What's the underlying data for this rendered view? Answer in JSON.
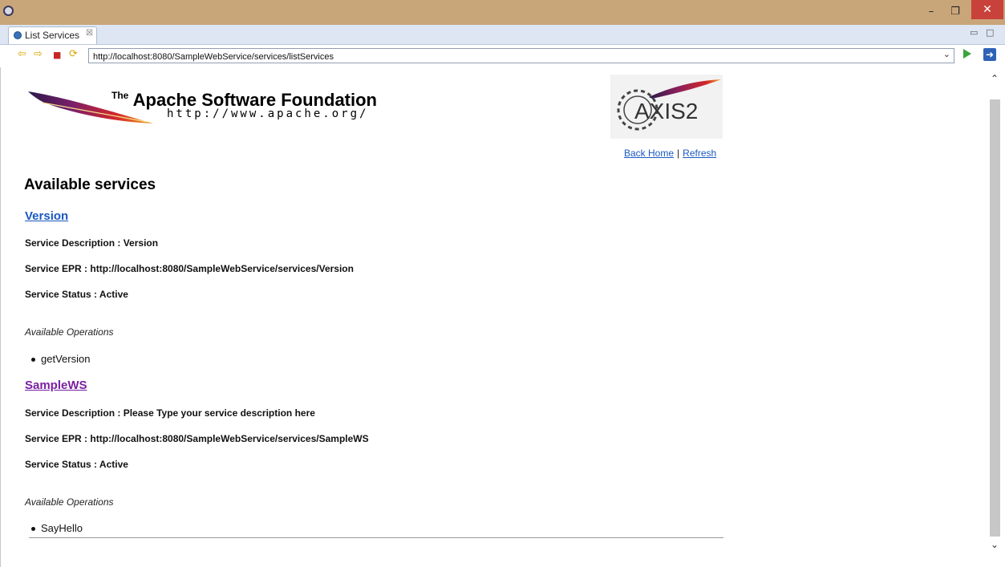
{
  "window": {
    "minimize": "–",
    "restore": "❐",
    "close": "✕"
  },
  "tab": {
    "label": "List Services",
    "close": "☒"
  },
  "tabbar": {
    "minimize": "▭",
    "maximize": "□"
  },
  "nav": {
    "url": "http://localhost:8080/SampleWebService/services/listServices",
    "dropdown": "⌄"
  },
  "header": {
    "asf_the": "The",
    "asf_title": "Apache Software Foundation",
    "asf_url": "http://www.apache.org/",
    "axis_logo_text": "AXIS2",
    "back_home": "Back Home",
    "separator": "|",
    "refresh": "Refresh"
  },
  "page": {
    "heading": "Available services",
    "services": [
      {
        "name": "Version",
        "description": "Service Description : Version",
        "epr": "Service EPR : http://localhost:8080/SampleWebService/services/Version",
        "status": "Service Status : Active",
        "operations_heading": "Available Operations",
        "operations": [
          "getVersion"
        ]
      },
      {
        "name": "SampleWS",
        "description": "Service Description : Please Type your service description here",
        "epr": "Service EPR : http://localhost:8080/SampleWebService/services/SampleWS",
        "status": "Service Status : Active",
        "operations_heading": "Available Operations",
        "operations": [
          "SayHello"
        ]
      }
    ]
  },
  "scroll": {
    "up": "⌃",
    "down": "⌄"
  },
  "colors": {
    "link": "#1a58c0",
    "visited": "#7a1fa0",
    "titlebar": "#c9a57a",
    "close": "#c8413b"
  }
}
